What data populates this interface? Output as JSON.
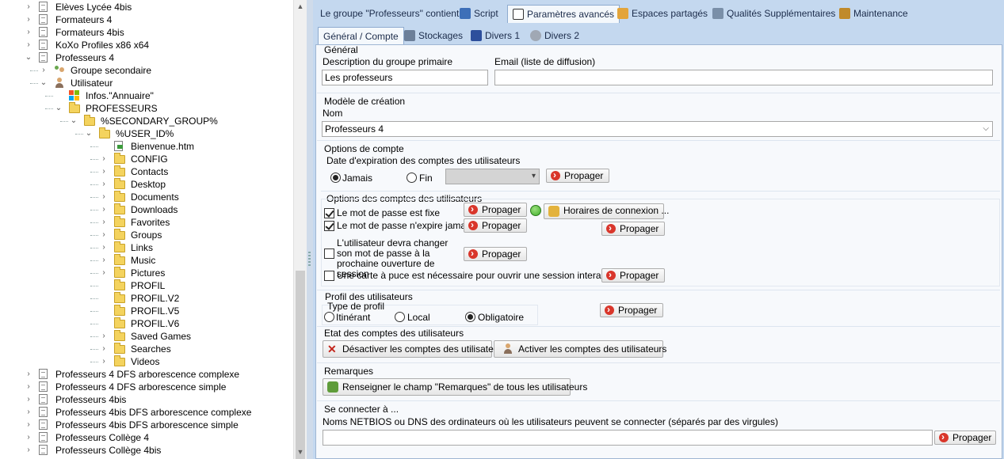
{
  "tree": {
    "items": [
      {
        "label": "Elèves Lycée 4bis",
        "level": 0,
        "expander": "›",
        "icon": "document-icon"
      },
      {
        "label": "Formateurs 4",
        "level": 0,
        "expander": "›",
        "icon": "document-icon"
      },
      {
        "label": "Formateurs 4bis",
        "level": 0,
        "expander": "›",
        "icon": "document-icon"
      },
      {
        "label": "KoXo Profiles x86 x64",
        "level": 0,
        "expander": "›",
        "icon": "document-icon"
      },
      {
        "label": "Professeurs 4",
        "level": 0,
        "expander": "⌄",
        "icon": "document-icon"
      },
      {
        "label": "Groupe secondaire",
        "level": 1,
        "expander": "›",
        "icon": "users-icon"
      },
      {
        "label": "Utilisateur",
        "level": 1,
        "expander": "⌄",
        "icon": "user-icon"
      },
      {
        "label": "Infos.\"Annuaire\"",
        "level": 2,
        "expander": "",
        "icon": "windows-icon"
      },
      {
        "label": "PROFESSEURS",
        "level": 2,
        "expander": "⌄",
        "icon": "folder-icon"
      },
      {
        "label": "%SECONDARY_GROUP%",
        "level": 3,
        "expander": "⌄",
        "icon": "folder-icon"
      },
      {
        "label": "%USER_ID%",
        "level": 4,
        "expander": "⌄",
        "icon": "folder-icon"
      },
      {
        "label": "Bienvenue.htm",
        "level": 5,
        "expander": "",
        "icon": "html-file-icon"
      },
      {
        "label": "CONFIG",
        "level": 5,
        "expander": "›",
        "icon": "folder-icon"
      },
      {
        "label": "Contacts",
        "level": 5,
        "expander": "›",
        "icon": "folder-icon"
      },
      {
        "label": "Desktop",
        "level": 5,
        "expander": "›",
        "icon": "folder-icon"
      },
      {
        "label": "Documents",
        "level": 5,
        "expander": "›",
        "icon": "folder-icon"
      },
      {
        "label": "Downloads",
        "level": 5,
        "expander": "›",
        "icon": "folder-icon"
      },
      {
        "label": "Favorites",
        "level": 5,
        "expander": "›",
        "icon": "folder-icon"
      },
      {
        "label": "Groups",
        "level": 5,
        "expander": "›",
        "icon": "folder-icon"
      },
      {
        "label": "Links",
        "level": 5,
        "expander": "›",
        "icon": "folder-icon"
      },
      {
        "label": "Music",
        "level": 5,
        "expander": "›",
        "icon": "folder-icon"
      },
      {
        "label": "Pictures",
        "level": 5,
        "expander": "›",
        "icon": "folder-icon"
      },
      {
        "label": "PROFIL",
        "level": 5,
        "expander": "",
        "icon": "folder-icon"
      },
      {
        "label": "PROFIL.V2",
        "level": 5,
        "expander": "",
        "icon": "folder-icon"
      },
      {
        "label": "PROFIL.V5",
        "level": 5,
        "expander": "",
        "icon": "folder-icon"
      },
      {
        "label": "PROFIL.V6",
        "level": 5,
        "expander": "",
        "icon": "folder-icon"
      },
      {
        "label": "Saved Games",
        "level": 5,
        "expander": "›",
        "icon": "folder-icon"
      },
      {
        "label": "Searches",
        "level": 5,
        "expander": "›",
        "icon": "folder-icon"
      },
      {
        "label": "Videos",
        "level": 5,
        "expander": "›",
        "icon": "folder-icon"
      },
      {
        "label": "Professeurs 4 DFS arborescence complexe",
        "level": 0,
        "expander": "›",
        "icon": "document-icon"
      },
      {
        "label": "Professeurs 4 DFS arborescence simple",
        "level": 0,
        "expander": "›",
        "icon": "document-icon"
      },
      {
        "label": "Professeurs 4bis",
        "level": 0,
        "expander": "›",
        "icon": "document-icon"
      },
      {
        "label": "Professeurs 4bis DFS arborescence complexe",
        "level": 0,
        "expander": "›",
        "icon": "document-icon"
      },
      {
        "label": "Professeurs 4bis DFS arborescence simple",
        "level": 0,
        "expander": "›",
        "icon": "document-icon"
      },
      {
        "label": "Professeurs Collège 4",
        "level": 0,
        "expander": "›",
        "icon": "document-icon"
      },
      {
        "label": "Professeurs Collège 4bis",
        "level": 0,
        "expander": "›",
        "icon": "document-icon"
      }
    ]
  },
  "top_tabs": [
    {
      "label": "Le groupe \"Professeurs\" contient",
      "icon": ""
    },
    {
      "label": "Script",
      "icon": "script-icon"
    },
    {
      "label": "Paramètres avancés",
      "icon": "advanced-settings-icon"
    },
    {
      "label": "Espaces partagés",
      "icon": "shared-spaces-icon"
    },
    {
      "label": "Qualités Supplémentaires",
      "icon": "qualities-icon"
    },
    {
      "label": "Maintenance",
      "icon": "maintenance-icon"
    }
  ],
  "sub_tabs": [
    {
      "label": "Général / Compte",
      "icon": ""
    },
    {
      "label": "Stockages",
      "icon": "storage-icon"
    },
    {
      "label": "Divers 1",
      "icon": "misc1-icon"
    },
    {
      "label": "Divers 2",
      "icon": "gear-icon"
    }
  ],
  "general": {
    "title": "Général",
    "desc_label": "Description du groupe primaire",
    "desc_value": "Les professeurs",
    "email_label": "Email (liste de diffusion)",
    "email_value": ""
  },
  "model": {
    "title": "Modèle de création",
    "name_label": "Nom",
    "name_value": "Professeurs 4"
  },
  "account_options": {
    "title": "Options de compte",
    "expiry_label": "Date d'expiration des comptes des utilisateurs",
    "never": "Jamais",
    "end": "Fin",
    "propagate": "Propager"
  },
  "user_account_options": {
    "title": "Options des comptes des utilisateurs",
    "pw_fixed": "Le mot de passe est fixe",
    "pw_never_expires": "Le mot de passe n'expire jamais",
    "must_change": "L'utilisateur devra changer son mot de passe à la prochaine ouverture de session",
    "smartcard": "Une carte à puce est nécessaire pour ouvrir une session interactive",
    "logon_hours": "Horaires de connexion ...",
    "propagate": "Propager"
  },
  "profile": {
    "title": "Profil des utilisateurs",
    "type_label": "Type de profil",
    "roaming": "Itinérant",
    "local": "Local",
    "mandatory": "Obligatoire",
    "propagate": "Propager"
  },
  "account_state": {
    "title": "Etat des comptes des utilisateurs",
    "disable": "Désactiver les comptes des utilisateurs",
    "enable": "Activer les comptes des utilisateurs"
  },
  "remarks": {
    "title": "Remarques",
    "fill": "Renseigner le champ \"Remarques\" de tous les utilisateurs"
  },
  "connect": {
    "title": "Se connecter à ...",
    "label": "Noms NETBIOS ou DNS des ordinateurs où les utilisateurs peuvent se connecter (séparés par des virgules)",
    "value": "",
    "propagate": "Propager"
  },
  "colors": {
    "accent": "#c4d8ef",
    "panel": "#f7f9fc",
    "propagate_icon": "#d9362b",
    "status_green": "#3fae2a"
  }
}
